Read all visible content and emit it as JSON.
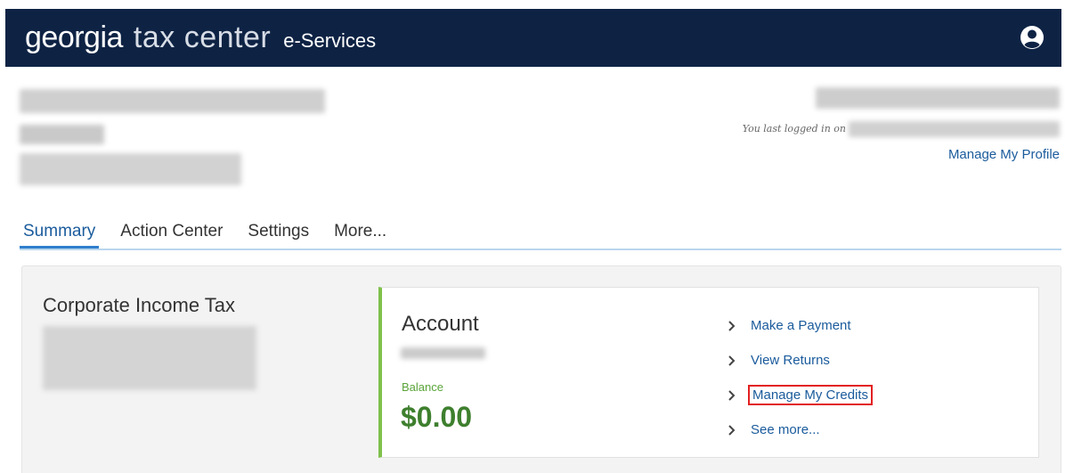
{
  "header": {
    "brand_georgia": "georgia",
    "brand_tax_center": "tax center",
    "brand_eservices": "e-Services",
    "bg_color": "#0e2344",
    "user_icon": "user-circle-icon"
  },
  "profile": {
    "last_logged_in_text": "You last logged in on",
    "manage_profile_label": "Manage My Profile"
  },
  "tabs": [
    {
      "label": "Summary",
      "active": true
    },
    {
      "label": "Action Center",
      "active": false
    },
    {
      "label": "Settings",
      "active": false
    },
    {
      "label": "More...",
      "active": false
    }
  ],
  "summary": {
    "tax_type": "Corporate Income Tax",
    "account": {
      "title": "Account",
      "balance_label": "Balance",
      "balance_value": "$0.00",
      "accent_color": "#7fc14b"
    },
    "links": [
      {
        "label": "Make a Payment",
        "highlighted": false
      },
      {
        "label": "View Returns",
        "highlighted": false
      },
      {
        "label": "Manage My Credits",
        "highlighted": true
      },
      {
        "label": "See more...",
        "highlighted": false
      }
    ]
  }
}
